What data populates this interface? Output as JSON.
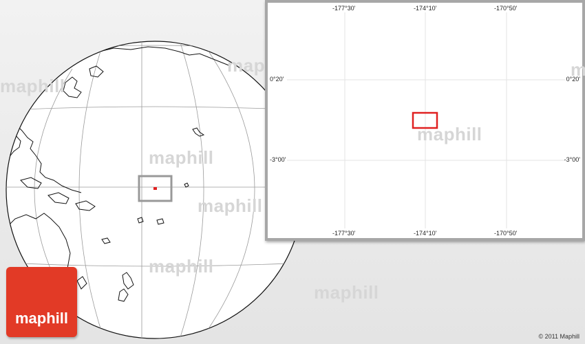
{
  "map": {
    "watermark_text": "maphill",
    "colors": {
      "background": "#ececec",
      "globe": "#ffffff",
      "graticule": "#9a9a9a",
      "frame": "#a7a7a7",
      "marker": "#e02020",
      "logo": "#e23a26"
    }
  },
  "inset": {
    "top_longitudes": [
      "-177°30'",
      "-174°10'",
      "-170°50'"
    ],
    "bottom_longitudes": [
      "-177°30'",
      "-174°10'",
      "-170°50'"
    ],
    "left_latitudes": [
      "0°20'",
      "-3°00'"
    ],
    "right_latitudes": [
      "0°20'",
      "-3°00'"
    ]
  },
  "logo": {
    "text": "maphill"
  },
  "footer": {
    "copyright": "© 2011 Maphill"
  }
}
